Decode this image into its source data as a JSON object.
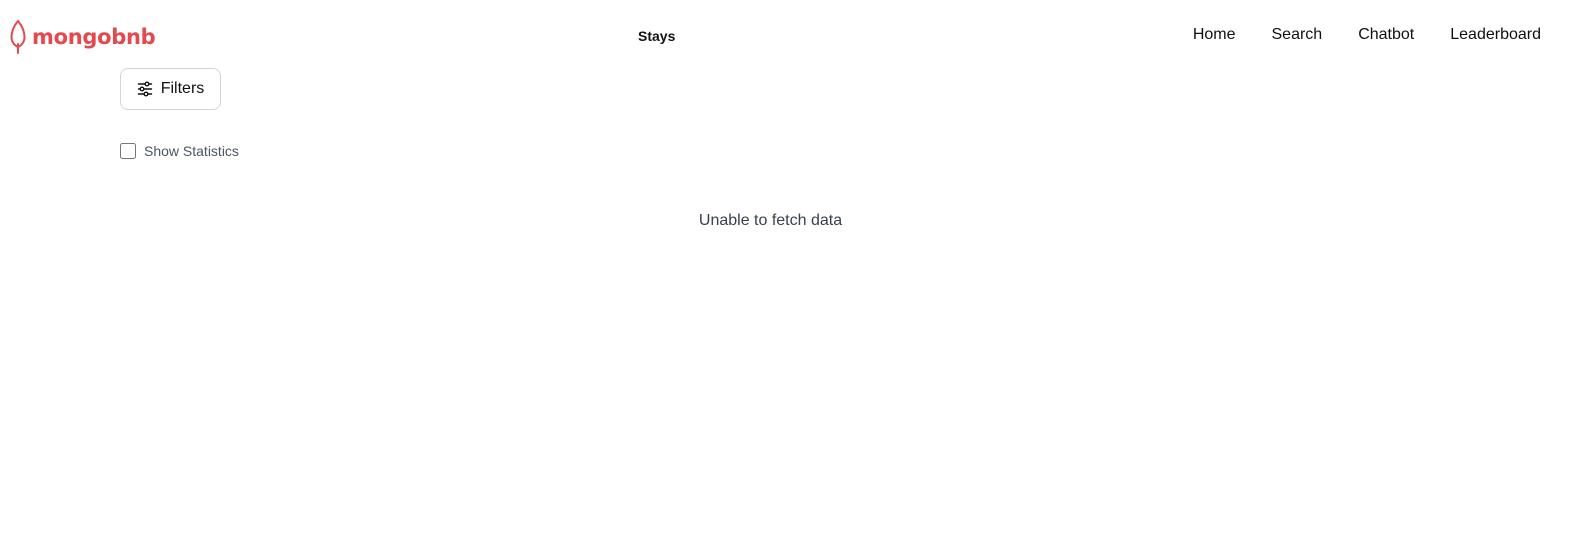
{
  "brand": {
    "name": "mongobnb",
    "icon": "leaf-icon",
    "color": "#e5484d"
  },
  "header": {
    "title": "Stays"
  },
  "nav": {
    "items": [
      {
        "label": "Home"
      },
      {
        "label": "Search"
      },
      {
        "label": "Chatbot"
      },
      {
        "label": "Leaderboard"
      }
    ]
  },
  "filters": {
    "label": "Filters",
    "icon": "sliders-icon"
  },
  "statistics": {
    "label": "Show Statistics",
    "checked": false
  },
  "status": {
    "message": "Unable to fetch data"
  }
}
